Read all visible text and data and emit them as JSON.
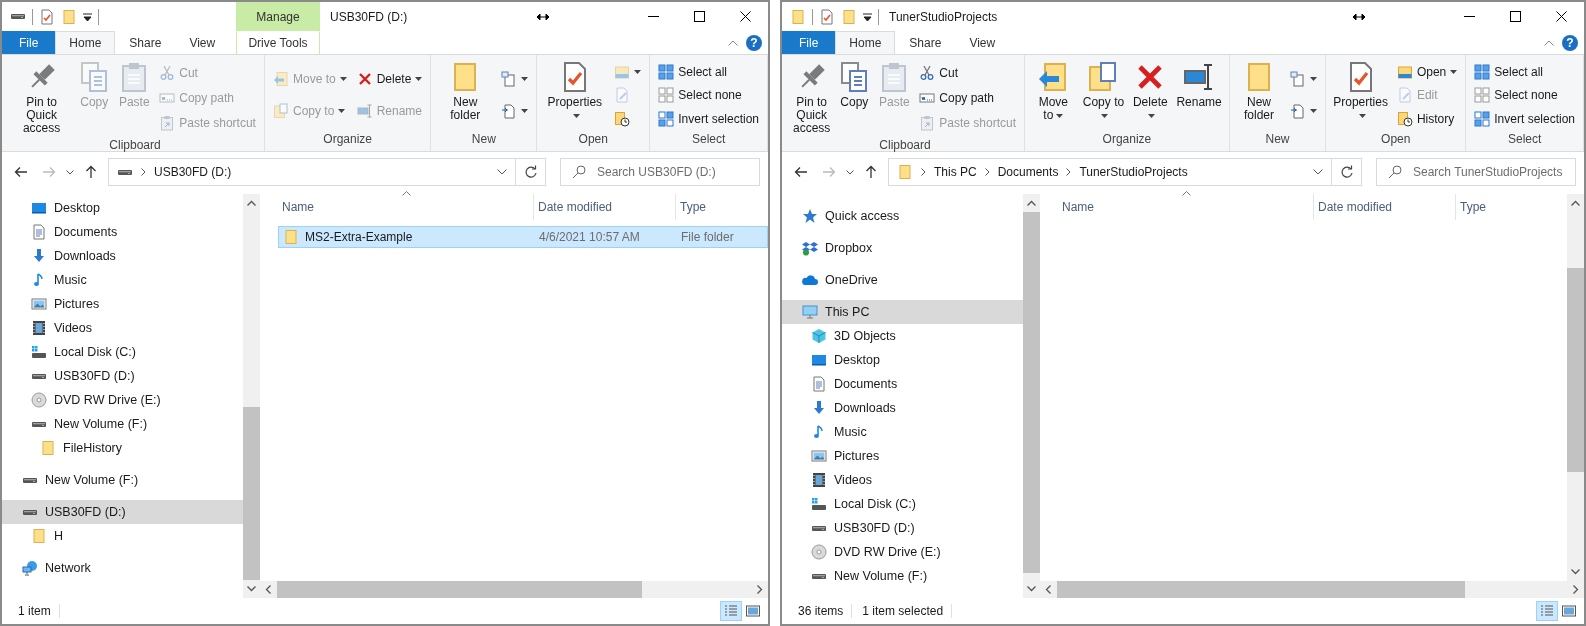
{
  "windows": [
    {
      "title": "USB30FD (D:)",
      "kind": "drive",
      "quick_toolbar": [
        {
          "kind": "properties"
        },
        {
          "kind": "newfolder"
        }
      ],
      "context_tab": {
        "header": "Manage",
        "label": "Drive Tools",
        "selected": false
      },
      "tabs": [
        {
          "label": "File",
          "kind": "file",
          "selected": false
        },
        {
          "label": "Home",
          "kind": "tab",
          "selected": true
        },
        {
          "label": "Share",
          "kind": "tab",
          "selected": false
        },
        {
          "label": "View",
          "kind": "tab",
          "selected": false
        }
      ],
      "help": "?",
      "ribbon": [
        {
          "label": "Clipboard",
          "columns": [
            [
              {
                "label": "Pin to Quick access",
                "kind": "pin",
                "disabled": false
              }
            ],
            [
              {
                "label": "Copy",
                "kind": "copy",
                "disabled": true
              }
            ],
            [
              {
                "label": "Paste",
                "kind": "paste",
                "disabled": true
              }
            ],
            [
              {
                "label": "Cut",
                "kind": "cut",
                "disabled": true
              },
              {
                "label": "Copy path",
                "kind": "copypath",
                "disabled": true
              },
              {
                "label": "Paste shortcut",
                "kind": "pasteshortcut",
                "disabled": true
              }
            ]
          ]
        },
        {
          "label": "Organize",
          "columns": [
            [
              {
                "label": "Move to",
                "kind": "moveto",
                "disabled": true,
                "menu": true
              },
              {
                "label": "Copy to",
                "kind": "copyto",
                "disabled": true,
                "menu": true
              }
            ],
            [
              {
                "label": "Delete",
                "kind": "delete",
                "disabled": false,
                "menu": true
              },
              {
                "label": "Rename",
                "kind": "rename",
                "disabled": true
              }
            ]
          ]
        },
        {
          "label": "New",
          "columns": [
            [
              {
                "label": "New folder",
                "kind": "newfolder",
                "disabled": false
              }
            ],
            [
              {
                "kind": "newitem",
                "disabled": false,
                "menu": true
              },
              {
                "kind": "easyaccess",
                "disabled": false,
                "menu": true
              }
            ]
          ]
        },
        {
          "label": "Open",
          "columns": [
            [
              {
                "label": "Properties",
                "kind": "properties",
                "disabled": false,
                "menu": true
              }
            ],
            [
              {
                "kind": "open",
                "disabled": true,
                "menu": true
              },
              {
                "kind": "edit",
                "disabled": true
              },
              {
                "kind": "history",
                "disabled": false
              }
            ]
          ]
        },
        {
          "label": "Select",
          "columns": [
            [
              {
                "label": "Select all",
                "kind": "selectall",
                "disabled": false
              },
              {
                "label": "Select none",
                "kind": "selectnone",
                "disabled": false
              },
              {
                "label": "Invert selection",
                "kind": "invert",
                "disabled": false
              }
            ]
          ]
        }
      ],
      "back": {
        "disabled": false
      },
      "forward": {
        "disabled": true
      },
      "address": {
        "kind": "drive",
        "crumbs": [
          "USB30FD (D:)"
        ]
      },
      "search": {
        "placeholder": "Search USB30FD (D:)"
      },
      "nav": [
        {
          "kind": "group",
          "children": [
            {
              "label": "Desktop",
              "kind": "desktop",
              "selected": false
            },
            {
              "label": "Documents",
              "kind": "documents",
              "selected": false
            },
            {
              "label": "Downloads",
              "kind": "downloads",
              "selected": false
            },
            {
              "label": "Music",
              "kind": "music",
              "selected": false
            },
            {
              "label": "Pictures",
              "kind": "pictures",
              "selected": false
            },
            {
              "label": "Videos",
              "kind": "videos",
              "selected": false
            },
            {
              "label": "Local Disk (C:)",
              "kind": "localdisk",
              "selected": false
            },
            {
              "label": "USB30FD (D:)",
              "kind": "drive",
              "selected": false
            },
            {
              "label": "DVD RW Drive (E:)",
              "kind": "dvd",
              "selected": false
            },
            {
              "label": "New Volume (F:)",
              "kind": "drive",
              "selected": false,
              "children": [
                {
                  "label": "FileHistory",
                  "kind": "folder",
                  "selected": false
                }
              ]
            }
          ]
        },
        {
          "label": "New Volume (F:)",
          "kind": "drive",
          "selected": false
        },
        {
          "label": "USB30FD (D:)",
          "kind": "drive",
          "selected": true,
          "children": [
            {
              "label": "H",
              "kind": "folder",
              "selected": false
            }
          ]
        },
        {
          "label": "Network",
          "kind": "network",
          "selected": false
        }
      ],
      "columns": [
        {
          "label": "Name",
          "sorted": true
        },
        {
          "label": "Date modified",
          "sorted": false
        },
        {
          "label": "Type",
          "sorted": false
        }
      ],
      "rows": [
        {
          "name": "MS2-Extra-Example",
          "kind": "folder",
          "date": "4/6/2021 10:57 AM",
          "type": "File folder",
          "selected": true
        }
      ],
      "status": [
        "1 item"
      ],
      "view_buttons": [
        {
          "kind": "details",
          "selected": true
        },
        {
          "kind": "tiles",
          "selected": false
        }
      ]
    },
    {
      "title": "TunerStudioProjects",
      "kind": "folder",
      "quick_toolbar": [
        {
          "kind": "properties"
        },
        {
          "kind": "newfolder"
        }
      ],
      "tabs": [
        {
          "label": "File",
          "kind": "file",
          "selected": false
        },
        {
          "label": "Home",
          "kind": "tab",
          "selected": true
        },
        {
          "label": "Share",
          "kind": "tab",
          "selected": false
        },
        {
          "label": "View",
          "kind": "tab",
          "selected": false
        }
      ],
      "help": "?",
      "ribbon": [
        {
          "label": "Clipboard",
          "columns": [
            [
              {
                "label": "Pin to Quick access",
                "kind": "pin",
                "disabled": false
              }
            ],
            [
              {
                "label": "Copy",
                "kind": "copy",
                "disabled": false
              }
            ],
            [
              {
                "label": "Paste",
                "kind": "paste",
                "disabled": true
              }
            ],
            [
              {
                "label": "Cut",
                "kind": "cut",
                "disabled": false
              },
              {
                "label": "Copy path",
                "kind": "copypath",
                "disabled": false
              },
              {
                "label": "Paste shortcut",
                "kind": "pasteshortcut",
                "disabled": true
              }
            ]
          ]
        },
        {
          "label": "Organize",
          "columns": [
            [
              {
                "label": "Move to",
                "kind": "moveto",
                "disabled": false,
                "menu": true
              }
            ],
            [
              {
                "label": "Copy to",
                "kind": "copyto",
                "disabled": false,
                "menu": true
              }
            ],
            [
              {
                "label": "Delete",
                "kind": "delete",
                "disabled": false,
                "menu": true
              }
            ],
            [
              {
                "label": "Rename",
                "kind": "rename",
                "disabled": false
              }
            ]
          ]
        },
        {
          "label": "New",
          "columns": [
            [
              {
                "label": "New folder",
                "kind": "newfolder",
                "disabled": false
              }
            ],
            [
              {
                "kind": "newitem",
                "disabled": false,
                "menu": true
              },
              {
                "kind": "easyaccess",
                "disabled": false,
                "menu": true
              }
            ]
          ]
        },
        {
          "label": "Open",
          "columns": [
            [
              {
                "label": "Properties",
                "kind": "properties",
                "disabled": false,
                "menu": true
              }
            ],
            [
              {
                "label": "Open",
                "kind": "open",
                "disabled": false,
                "menu": true
              },
              {
                "label": "Edit",
                "kind": "edit",
                "disabled": true
              },
              {
                "label": "History",
                "kind": "history",
                "disabled": false
              }
            ]
          ]
        },
        {
          "label": "Select",
          "columns": [
            [
              {
                "label": "Select all",
                "kind": "selectall",
                "disabled": false
              },
              {
                "label": "Select none",
                "kind": "selectnone",
                "disabled": false
              },
              {
                "label": "Invert selection",
                "kind": "invert",
                "disabled": false
              }
            ]
          ]
        }
      ],
      "back": {
        "disabled": false
      },
      "forward": {
        "disabled": true
      },
      "address": {
        "kind": "folder",
        "crumbs": [
          "This PC",
          "Documents",
          "TunerStudioProjects"
        ]
      },
      "search": {
        "placeholder": "Search TunerStudioProjects"
      },
      "nav": [
        {
          "label": "Quick access",
          "kind": "quickaccess",
          "selected": false
        },
        {
          "label": "Dropbox",
          "kind": "dropbox",
          "selected": false
        },
        {
          "label": "OneDrive",
          "kind": "onedrive",
          "selected": false
        },
        {
          "label": "This PC",
          "kind": "pc",
          "selected": true,
          "children": [
            {
              "label": "3D Objects",
              "kind": "objects3d",
              "selected": false
            },
            {
              "label": "Desktop",
              "kind": "desktop",
              "selected": false
            },
            {
              "label": "Documents",
              "kind": "documents",
              "selected": false
            },
            {
              "label": "Downloads",
              "kind": "downloads",
              "selected": false
            },
            {
              "label": "Music",
              "kind": "music",
              "selected": false
            },
            {
              "label": "Pictures",
              "kind": "pictures",
              "selected": false
            },
            {
              "label": "Videos",
              "kind": "videos",
              "selected": false
            },
            {
              "label": "Local Disk (C:)",
              "kind": "localdisk",
              "selected": false
            },
            {
              "label": "USB30FD (D:)",
              "kind": "drive",
              "selected": false
            },
            {
              "label": "DVD RW Drive (E:)",
              "kind": "dvd",
              "selected": false
            },
            {
              "label": "New Volume (F:)",
              "kind": "drive",
              "selected": false
            }
          ]
        }
      ],
      "columns": [
        {
          "label": "Name",
          "sorted": true
        },
        {
          "label": "Date modified",
          "sorted": false
        },
        {
          "label": "Type",
          "sorted": false
        }
      ],
      "status": [
        "36 items",
        "1 item selected"
      ],
      "view_buttons": [
        {
          "kind": "details",
          "selected": true
        },
        {
          "kind": "tiles",
          "selected": false
        }
      ]
    }
  ]
}
